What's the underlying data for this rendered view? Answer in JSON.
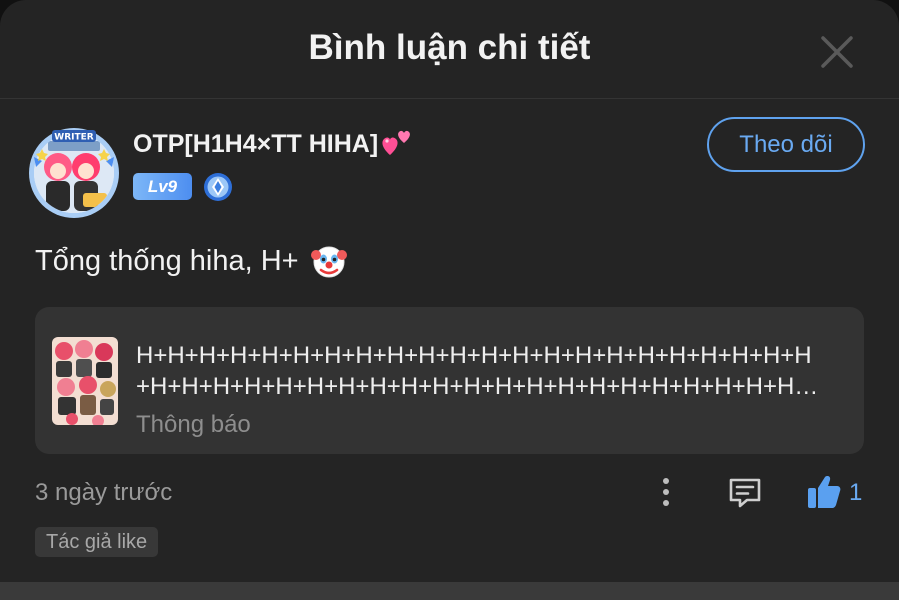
{
  "header": {
    "title": "Bình luận chi tiết",
    "close_icon": "close-icon"
  },
  "comment": {
    "user": {
      "name": "OTP[H1H4×TT HIHA]",
      "name_icon": "two-hearts-emoji",
      "level": "Lv9",
      "rank_icon": "rank-badge-icon",
      "avatar_icon": "avatar-image"
    },
    "follow_label": "Theo dõi",
    "text": "Tổng thống hiha, H+",
    "text_emoji": "clown-face-emoji",
    "reference": {
      "line1": "H+H+H+H+H+H+H+H+H+H+H+H+H+H+H+H+H+H+H+H+H+H",
      "line2": "+H+H+H+H+H+H+H+H+H+H+H+H+H+H+H+H+H+H+H+H+H…",
      "subtitle": "Thông báo",
      "thumb_icon": "cover-thumbnail-image"
    },
    "time": "3 ngày trước",
    "actions": {
      "more_icon": "more-vertical-icon",
      "reply_icon": "comment-icon",
      "like_icon": "thumbs-up-icon",
      "like_count": "1"
    },
    "author_tag": "Tác giả like"
  },
  "colors": {
    "accent": "#5fa2ee",
    "background": "#242424",
    "card": "#333333"
  }
}
